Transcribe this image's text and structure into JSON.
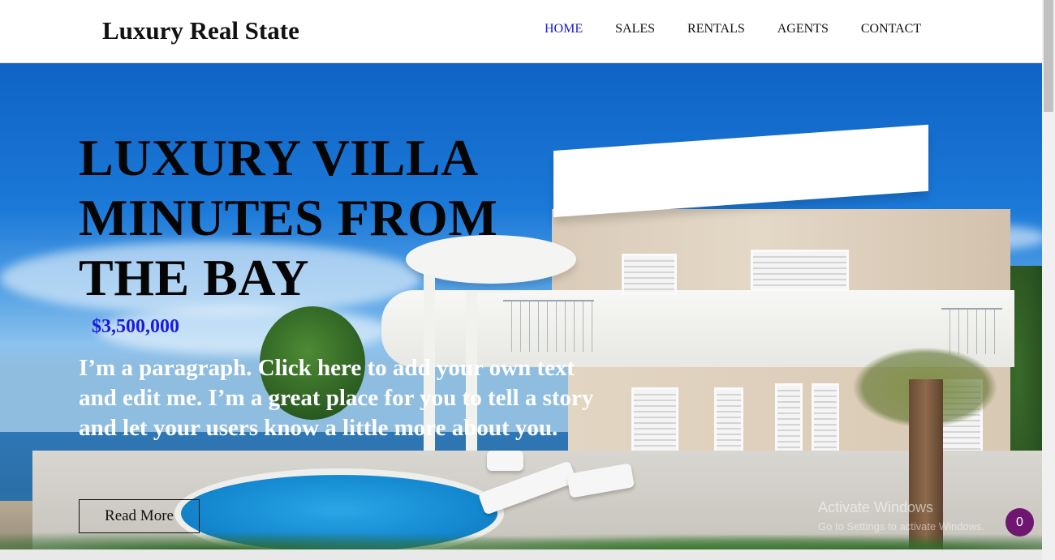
{
  "header": {
    "brand": "Luxury Real State",
    "nav": [
      {
        "label": "HOME",
        "active": true
      },
      {
        "label": "SALES",
        "active": false
      },
      {
        "label": "RENTALS",
        "active": false
      },
      {
        "label": "AGENTS",
        "active": false
      },
      {
        "label": "CONTACT",
        "active": false
      }
    ]
  },
  "hero": {
    "title": "LUXURY VILLA MINUTES FROM THE BAY",
    "price": "$3,500,000",
    "paragraph": "I’m a paragraph. Click here to add your own text and edit me. I’m a great place for you to tell a story and let your users know a little more about you.",
    "button_label": "Read More"
  },
  "overlay": {
    "watermark_title": "Activate Windows",
    "watermark_sub": "Go to Settings to activate Windows.",
    "badge_count": "0"
  },
  "colors": {
    "nav_active": "#1a1ad6",
    "price": "#1a1ae0",
    "badge": "#6e1670"
  }
}
